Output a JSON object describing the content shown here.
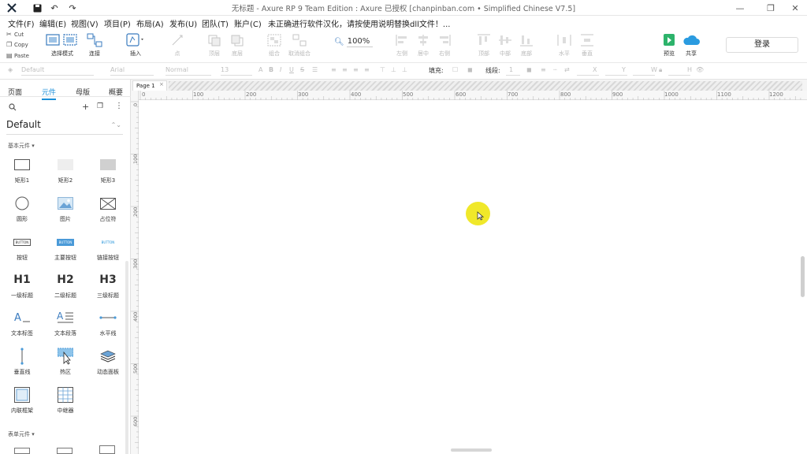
{
  "window": {
    "title": "无标题 - Axure RP 9 Team Edition : Axure 已授权   [chanpinban.com • Simplified Chinese V7.5]"
  },
  "menu": [
    "文件(F)",
    "编辑(E)",
    "视图(V)",
    "项目(P)",
    "布局(A)",
    "发布(U)",
    "团队(T)",
    "账户(C)",
    "未正确进行软件汉化，请按使用说明替换dll文件！..."
  ],
  "clipboard": {
    "cut": "Cut",
    "copy": "Copy",
    "paste": "Paste"
  },
  "toolbar": {
    "select_mode": "选择模式",
    "connect": "连接",
    "insert": "插入",
    "point": "点",
    "top_layer": "顶层",
    "bottom_layer": "底层",
    "group": "组合",
    "ungroup": "取消组合",
    "zoom": "100%",
    "left": "左侧",
    "center": "居中",
    "right": "右侧",
    "top": "顶部",
    "middle": "中部",
    "bottom": "底部",
    "horizontal": "水平",
    "vertical": "垂直",
    "preview": "预览",
    "share": "共享",
    "login": "登录"
  },
  "format": {
    "style": "Default",
    "font": "Arial",
    "weight": "Normal",
    "size": "13",
    "fill_label": "填充:",
    "stroke_label": "线段:",
    "stroke_value": "1",
    "x_label": "X",
    "y_label": "Y",
    "w_label": "W",
    "h_label": "H"
  },
  "panel": {
    "tabs": [
      "页面",
      "元件",
      "母版",
      "概要"
    ],
    "active_tab": 1,
    "library": "Default",
    "section_basic": "基本元件 ▾",
    "section_form": "表单元件 ▾",
    "widgets": [
      "矩形1",
      "矩形2",
      "矩形3",
      "圆形",
      "图片",
      "占位符",
      "按钮",
      "主要按钮",
      "链接按钮",
      "一级标题",
      "二级标题",
      "三级标题",
      "文本标签",
      "文本段落",
      "水平线",
      "垂直线",
      "热区",
      "动态面板",
      "内联框架",
      "中继器"
    ],
    "button_text": "BUTTON",
    "h1": "H1",
    "h2": "H2",
    "h3": "H3"
  },
  "document": {
    "tab": "Page 1"
  },
  "ruler": {
    "h": [
      "0",
      "100",
      "200",
      "300",
      "400",
      "500",
      "600",
      "700",
      "800",
      "900",
      "1000",
      "1100",
      "1200"
    ],
    "v": [
      "0",
      "100",
      "200",
      "300",
      "400",
      "500",
      "600"
    ]
  },
  "colors": {
    "accent": "#1a8ed8",
    "highlight": "#f0e82a",
    "preview_green": "#2db36b"
  }
}
